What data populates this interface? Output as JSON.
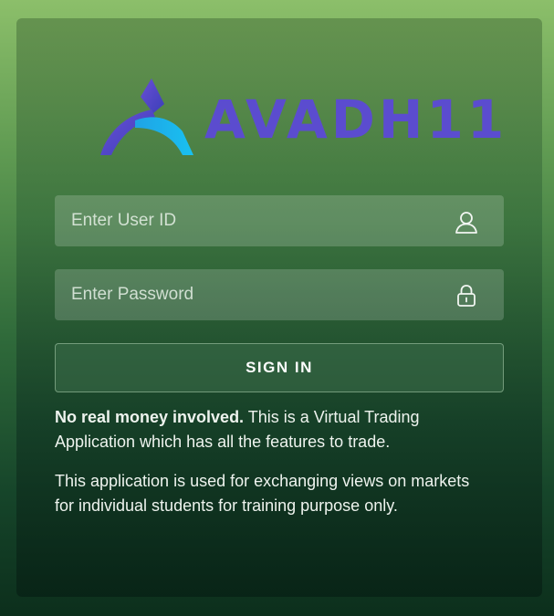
{
  "brand": {
    "name": "AVADH11",
    "primary_color": "#5b4ccf",
    "accent_color": "#1fa3e6"
  },
  "login": {
    "user_id_placeholder": "Enter User ID",
    "password_placeholder": "Enter Password",
    "user_icon": "user-icon",
    "password_icon": "lock-icon",
    "sign_in_label": "SIGN IN"
  },
  "notes": {
    "disclaimer_bold": "No real money involved.",
    "disclaimer_rest": " This is a Virtual Trading Application which has all the features to trade.",
    "purpose": "This application is used for exchanging views on markets for individual students for training purpose only."
  }
}
